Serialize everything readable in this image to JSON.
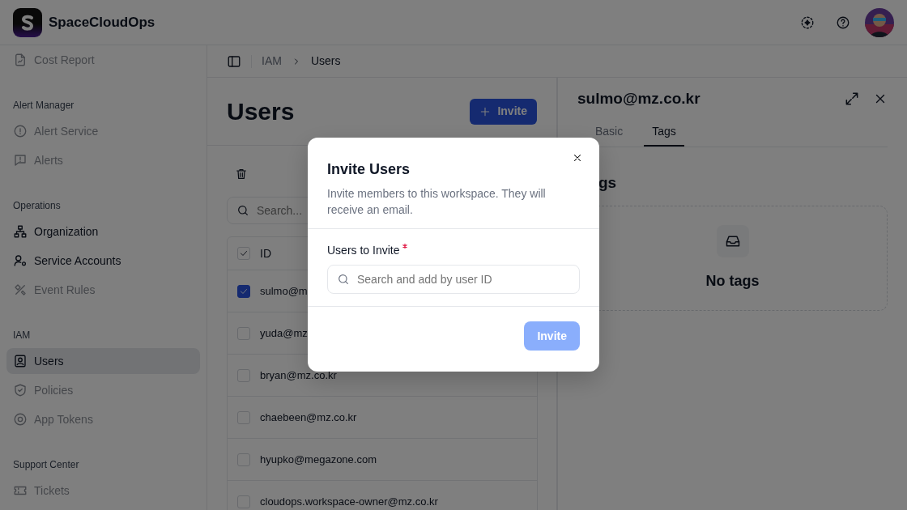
{
  "app": {
    "name": "SpaceCloudOps"
  },
  "sidebar": {
    "sections": [
      {
        "items": [
          {
            "label": "Cost Report",
            "selected": false,
            "disabled": true
          }
        ]
      },
      {
        "heading": "Alert Manager",
        "items": [
          {
            "label": "Alert Service",
            "selected": false,
            "disabled": true
          },
          {
            "label": "Alerts",
            "selected": false,
            "disabled": true
          }
        ]
      },
      {
        "heading": "Operations",
        "items": [
          {
            "label": "Organization",
            "selected": false,
            "disabled": false
          },
          {
            "label": "Service Accounts",
            "selected": false,
            "disabled": false
          },
          {
            "label": "Event Rules",
            "selected": false,
            "disabled": true
          }
        ]
      },
      {
        "heading": "IAM",
        "items": [
          {
            "label": "Users",
            "selected": true,
            "disabled": false
          },
          {
            "label": "Policies",
            "selected": false,
            "disabled": true
          },
          {
            "label": "App Tokens",
            "selected": false,
            "disabled": true
          }
        ]
      },
      {
        "heading": "Support Center",
        "items": [
          {
            "label": "Tickets",
            "selected": false,
            "disabled": true
          }
        ]
      }
    ]
  },
  "breadcrumb": [
    "IAM",
    "Users"
  ],
  "page": {
    "title": "Users",
    "invite_button": "Invite",
    "search": {
      "placeholder": "Search..."
    }
  },
  "table": {
    "columns": [
      "ID"
    ],
    "all_checked": true,
    "rows": [
      {
        "id": "sulmo@m",
        "checked": true
      },
      {
        "id": "yuda@mz",
        "checked": false
      },
      {
        "id": "bryan@mz.co.kr",
        "checked": false
      },
      {
        "id": "chaebeen@mz.co.kr",
        "checked": false
      },
      {
        "id": "hyupko@megazone.com",
        "checked": false
      },
      {
        "id": "cloudops.workspace-owner@mz.co.kr",
        "checked": false
      }
    ]
  },
  "detail": {
    "title": "sulmo@mz.co.kr",
    "tabs": [
      {
        "label": "Basic",
        "selected": false
      },
      {
        "label": "Tags",
        "selected": true
      }
    ],
    "heading": "gs",
    "empty_text": "No tags"
  },
  "dialog": {
    "title": "Invite Users",
    "description": "Invite members to this workspace. They will receive an email.",
    "field_label": "Users to Invite",
    "required": true,
    "field": {
      "placeholder": "Search and add by user ID"
    },
    "submit": {
      "label": "Invite",
      "disabled": true
    }
  }
}
